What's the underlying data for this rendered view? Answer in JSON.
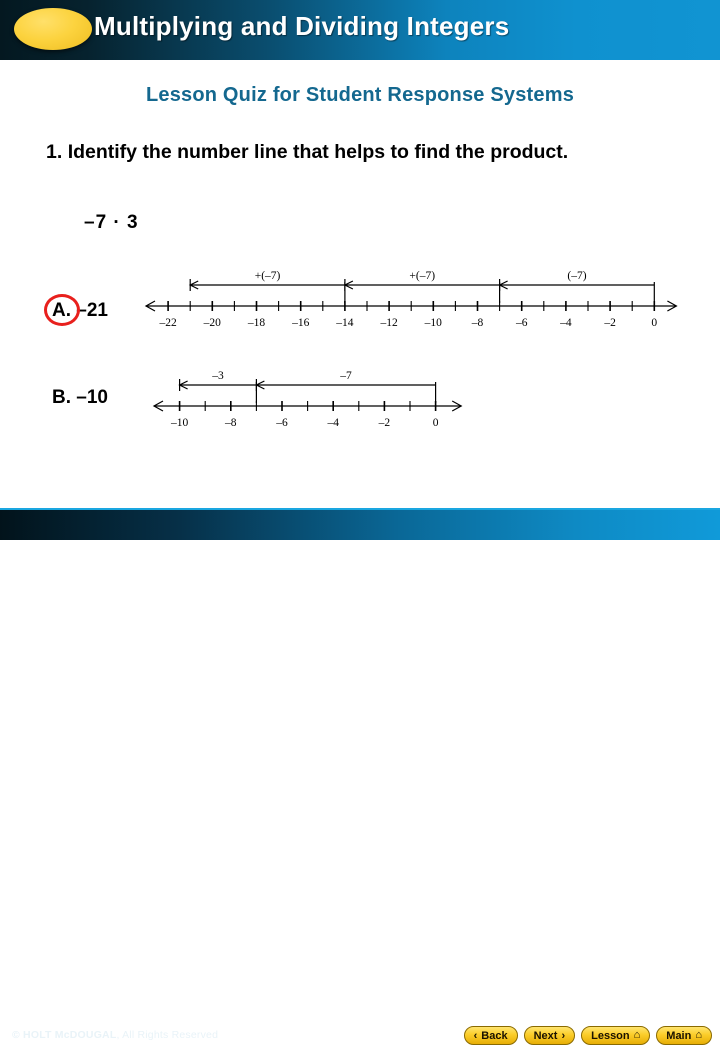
{
  "header": {
    "title": "Multiplying and Dividing Integers",
    "ellipse_color": "#fbd23f",
    "gradient_from": "#041820",
    "gradient_to": "#1194d2"
  },
  "subtitle": {
    "text": "Lesson Quiz for Student Response Systems",
    "color": "#14688f"
  },
  "question": {
    "number": "1.",
    "text": "Identify the number line that helps to find the product.",
    "expression": "–7 · 3"
  },
  "answers": [
    {
      "key": "A.",
      "value": "–21",
      "selected": true,
      "selection_color": "#e8201d"
    },
    {
      "key": "B.",
      "value": "–10",
      "selected": false,
      "selection_color": "#e8201d"
    }
  ],
  "numberlines": [
    {
      "name": "numberline-a",
      "min": -23,
      "max": 1,
      "tick_step": 1,
      "labels": [
        {
          "value": -22,
          "text": "–22"
        },
        {
          "value": -20,
          "text": "–20"
        },
        {
          "value": -18,
          "text": "–18"
        },
        {
          "value": -16,
          "text": "–16"
        },
        {
          "value": -14,
          "text": "–14"
        },
        {
          "value": -12,
          "text": "–12"
        },
        {
          "value": -10,
          "text": "–10"
        },
        {
          "value": -8,
          "text": "–8"
        },
        {
          "value": -6,
          "text": "–6"
        },
        {
          "value": -4,
          "text": "–4"
        },
        {
          "value": -2,
          "text": "–2"
        },
        {
          "value": 0,
          "text": "0"
        }
      ],
      "jumps": [
        {
          "from": -14,
          "to": -21,
          "label": "+(–7)"
        },
        {
          "from": -7,
          "to": -14,
          "label": "+(–7)"
        },
        {
          "from": 0,
          "to": -7,
          "label": "(–7)"
        }
      ],
      "left_arrow": true,
      "right_arrow": true
    },
    {
      "name": "numberline-b",
      "min": -11,
      "max": 1,
      "tick_step": 1,
      "labels": [
        {
          "value": -10,
          "text": "–10"
        },
        {
          "value": -8,
          "text": "–8"
        },
        {
          "value": -6,
          "text": "–6"
        },
        {
          "value": -4,
          "text": "–4"
        },
        {
          "value": -2,
          "text": "–2"
        },
        {
          "value": 0,
          "text": "0"
        }
      ],
      "jumps": [
        {
          "from": -7,
          "to": -10,
          "label": "–3"
        },
        {
          "from": 0,
          "to": -7,
          "label": "–7"
        }
      ],
      "left_arrow": true,
      "right_arrow": true
    }
  ],
  "footer": {
    "copyright_bold": "© HOLT McDOUGAL",
    "copyright_rest": ", All Rights Reserved",
    "buttons": [
      {
        "name": "back-button",
        "label": "Back",
        "icon": "chevron-left-icon",
        "glyph": "‹",
        "icon_side": "left"
      },
      {
        "name": "next-button",
        "label": "Next",
        "icon": "chevron-right-icon",
        "glyph": "›",
        "icon_side": "right"
      },
      {
        "name": "lesson-button",
        "label": "Lesson",
        "icon": "home-icon",
        "glyph": "⌂",
        "icon_side": "right"
      },
      {
        "name": "main-button",
        "label": "Main",
        "icon": "home-icon",
        "glyph": "⌂",
        "icon_side": "right"
      }
    ]
  }
}
